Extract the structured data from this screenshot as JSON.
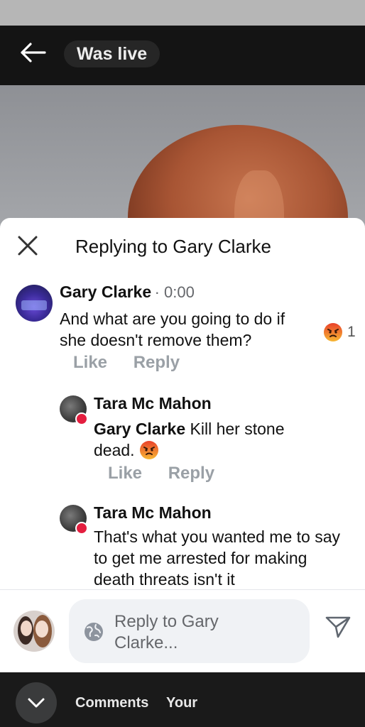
{
  "header": {
    "live_label": "Was live"
  },
  "sheet": {
    "title": "Replying to Gary Clarke"
  },
  "comments": [
    {
      "author": "Gary Clarke",
      "meta": "· 0:00",
      "text": "And what are you going to do if she doesn't remove them?",
      "reaction_icon": "angry-emoji",
      "reaction_count": "1",
      "like_label": "Like",
      "reply_label": "Reply"
    },
    {
      "author": "Tara Mc Mahon",
      "mention": "Gary Clarke",
      "text": " Kill her stone dead. ",
      "emoji": "angry-emoji",
      "like_label": "Like",
      "reply_label": "Reply"
    },
    {
      "author": "Tara Mc Mahon",
      "text": "That's what you wanted me to say to get me arrested for making death threats isn't it"
    }
  ],
  "composer": {
    "placeholder": "Reply to Gary Clarke..."
  },
  "bottom_bar": {
    "tab_comments": "Comments",
    "tab_your": "Your"
  },
  "colors": {
    "accent_angry": "#f06a2a",
    "badge_red": "#e41e3f",
    "action_gray": "#9aa0a6"
  }
}
